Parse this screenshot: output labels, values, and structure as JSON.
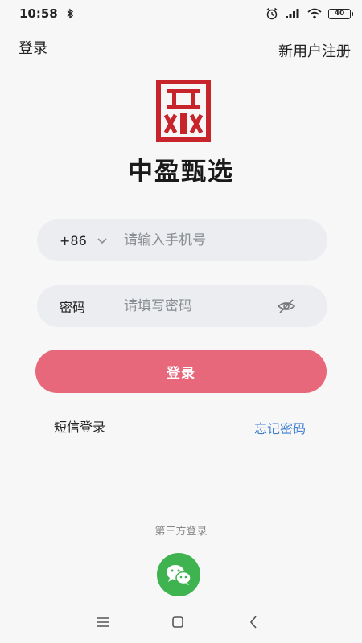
{
  "status": {
    "time": "10:58",
    "battery": "40"
  },
  "nav": {
    "login_tab": "登录",
    "register": "新用户注册"
  },
  "brand": {
    "name": "中盈甄选",
    "color": "#c8242b"
  },
  "phone": {
    "country_code": "+86",
    "placeholder": "请输入手机号"
  },
  "password": {
    "label": "密码",
    "placeholder": "请填写密码"
  },
  "login_button": {
    "label": "登录",
    "color": "#e8687b"
  },
  "links": {
    "sms_login": "短信登录",
    "forgot_password": "忘记密码"
  },
  "third_party": {
    "label": "第三方登录",
    "wechat_color": "#3fb34f"
  },
  "icons": [
    "bluetooth-icon",
    "alarm-icon",
    "signal-icon",
    "wifi-icon",
    "battery-icon",
    "chevron-down-icon",
    "eye-off-icon",
    "wechat-icon",
    "menu-icon",
    "home-icon",
    "back-icon"
  ]
}
